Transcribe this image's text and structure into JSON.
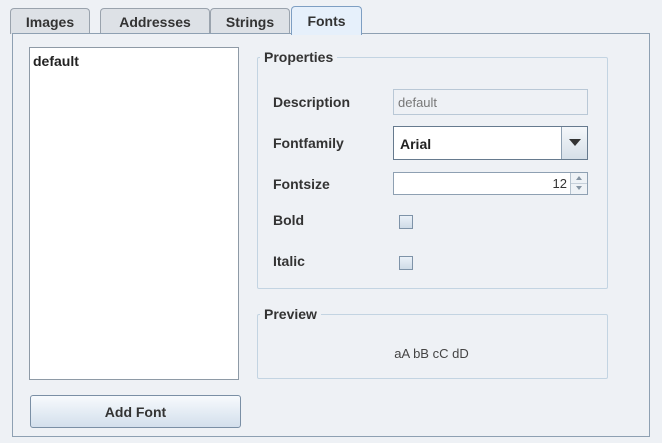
{
  "tabs": [
    {
      "label": "Images",
      "active": false
    },
    {
      "label": "Addresses",
      "active": false
    },
    {
      "label": "Strings",
      "active": false
    },
    {
      "label": "Fonts",
      "active": true
    }
  ],
  "font_list": {
    "items": [
      "default"
    ]
  },
  "add_font_button": "Add Font",
  "properties": {
    "title": "Properties",
    "description_label": "Description",
    "description_value": "default",
    "fontfamily_label": "Fontfamily",
    "fontfamily_value": "Arial",
    "fontsize_label": "Fontsize",
    "fontsize_value": "12",
    "bold_label": "Bold",
    "bold_checked": false,
    "italic_label": "Italic",
    "italic_checked": false
  },
  "preview": {
    "title": "Preview",
    "sample_text": "aA bB cC dD"
  },
  "colors": {
    "background": "#eef1f5",
    "active_tab": "#e6f0fb",
    "group_border": "#c3d4e2"
  }
}
